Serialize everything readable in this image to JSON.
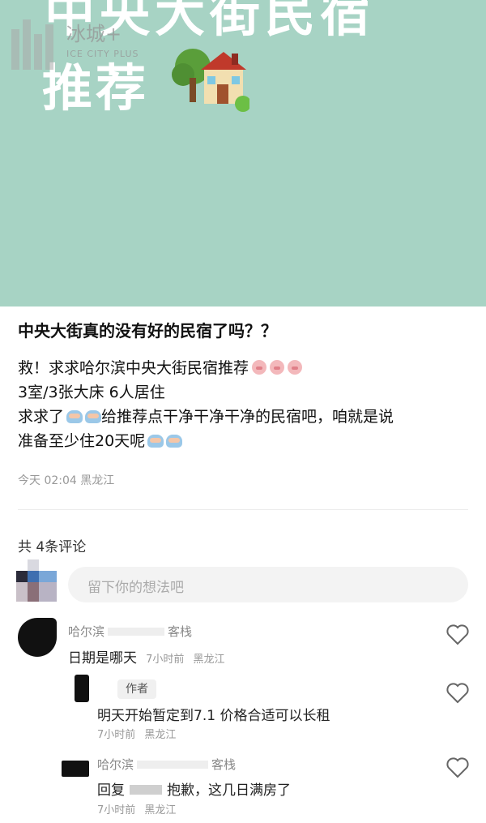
{
  "cover": {
    "title_line1": "中央大街民宿",
    "title_line2": "推荐",
    "watermark_name": "冰城+",
    "watermark_sub": "ICE CITY PLUS",
    "bg_color": "#a7d3c4"
  },
  "post": {
    "title": "中央大街真的没有好的民宿了吗？？",
    "line1": "救！求求哈尔滨中央大街民宿推荐",
    "line2": "3室/3张大床 6人居住",
    "line3a": "求求了",
    "line3b": "给推荐点干净干净干净的民宿吧，咱就是说",
    "line4": "准备至少住20天呢",
    "meta": "今天 02:04 黑龙江"
  },
  "comments_header": {
    "count_label": "共 4条评论"
  },
  "input": {
    "placeholder": "留下你的想法吧"
  },
  "comments": [
    {
      "name_a": "哈尔滨",
      "name_b": "客栈",
      "text": "日期是哪天",
      "time": "7小时前",
      "location": "黑龙江"
    },
    {
      "tag": "作者",
      "text": "明天开始暂定到7.1 价格合适可以长租",
      "time": "7小时前",
      "location": "黑龙江"
    },
    {
      "name_a": "哈尔滨",
      "name_b": "客栈",
      "text_a": "回复",
      "text_b": "抱歉，这几日满房了",
      "time": "7小时前",
      "location": "黑龙江"
    }
  ],
  "icons": {
    "like": "heart-outline-icon",
    "house": "house-with-tree-emoji"
  }
}
